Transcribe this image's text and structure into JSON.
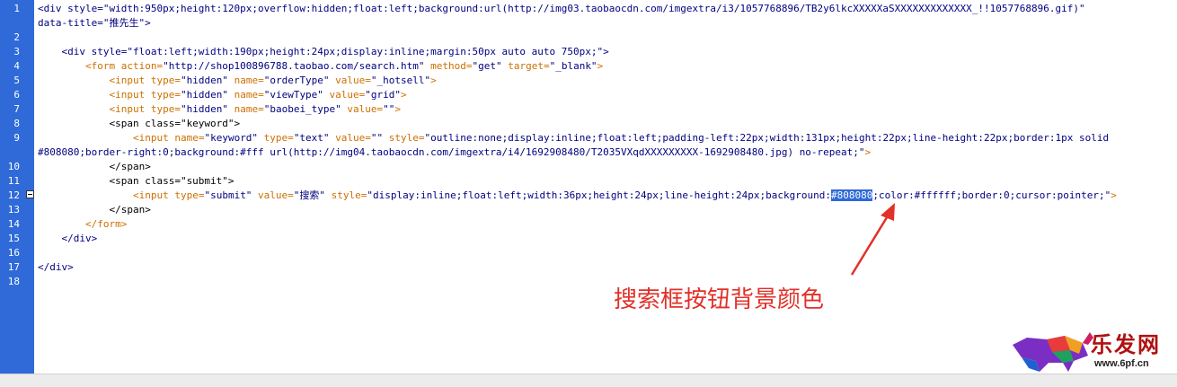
{
  "editor": {
    "line_numbers": [
      "1",
      "2",
      "3",
      "4",
      "5",
      "6",
      "7",
      "8",
      "9",
      "10",
      "11",
      "12",
      "13",
      "14",
      "15",
      "16",
      "17",
      "18"
    ],
    "lines": [
      {
        "num": 1,
        "parts": [
          {
            "text": "<div style=\"width:950px;height:120px;overflow:hidden;float:left;background:url(http://img03.taobaocdn.com/imgextra/i3/1057768896/TB2y6lkcXXXXXaSXXXXXXXXXXXXX_!!1057768896.gif)\"",
            "cls": "t"
          }
        ]
      },
      {
        "num": 0,
        "parts": [
          {
            "text": "data-title=\"推先生\">",
            "cls": "t"
          }
        ]
      },
      {
        "num": 2,
        "parts": []
      },
      {
        "num": 3,
        "parts": [
          {
            "text": "    <div style=\"float:left;width:190px;height:24px;display:inline;margin:50px auto auto 750px;\">",
            "cls": "t"
          }
        ]
      },
      {
        "num": 4,
        "parts": [
          {
            "text": "        <form ",
            "cls": "o"
          },
          {
            "text": "action=",
            "cls": "o"
          },
          {
            "text": "\"http://shop100896788.taobao.com/search.htm\"",
            "cls": "t"
          },
          {
            "text": " method=",
            "cls": "o"
          },
          {
            "text": "\"get\"",
            "cls": "t"
          },
          {
            "text": " target=",
            "cls": "o"
          },
          {
            "text": "\"_blank\"",
            "cls": "t"
          },
          {
            "text": ">",
            "cls": "o"
          }
        ]
      },
      {
        "num": 5,
        "parts": [
          {
            "text": "            <input ",
            "cls": "o"
          },
          {
            "text": "type=",
            "cls": "o"
          },
          {
            "text": "\"hidden\"",
            "cls": "t"
          },
          {
            "text": " name=",
            "cls": "o"
          },
          {
            "text": "\"orderType\"",
            "cls": "t"
          },
          {
            "text": " value=",
            "cls": "o"
          },
          {
            "text": "\"_hotsell\"",
            "cls": "t"
          },
          {
            "text": ">",
            "cls": "o"
          }
        ]
      },
      {
        "num": 6,
        "parts": [
          {
            "text": "            <input ",
            "cls": "o"
          },
          {
            "text": "type=",
            "cls": "o"
          },
          {
            "text": "\"hidden\"",
            "cls": "t"
          },
          {
            "text": " name=",
            "cls": "o"
          },
          {
            "text": "\"viewType\"",
            "cls": "t"
          },
          {
            "text": " value=",
            "cls": "o"
          },
          {
            "text": "\"grid\"",
            "cls": "t"
          },
          {
            "text": ">",
            "cls": "o"
          }
        ]
      },
      {
        "num": 7,
        "parts": [
          {
            "text": "            <input ",
            "cls": "o"
          },
          {
            "text": "type=",
            "cls": "o"
          },
          {
            "text": "\"hidden\"",
            "cls": "t"
          },
          {
            "text": " name=",
            "cls": "o"
          },
          {
            "text": "\"baobei_type\"",
            "cls": "t"
          },
          {
            "text": " value=",
            "cls": "o"
          },
          {
            "text": "\"\"",
            "cls": "t"
          },
          {
            "text": ">",
            "cls": "o"
          }
        ]
      },
      {
        "num": 8,
        "parts": [
          {
            "text": "            <span class=\"keyword\">",
            "cls": "a"
          }
        ]
      },
      {
        "num": 9,
        "parts": [
          {
            "text": "                <input ",
            "cls": "o"
          },
          {
            "text": "name=",
            "cls": "o"
          },
          {
            "text": "\"keyword\"",
            "cls": "t"
          },
          {
            "text": " type=",
            "cls": "o"
          },
          {
            "text": "\"text\"",
            "cls": "t"
          },
          {
            "text": " value=",
            "cls": "o"
          },
          {
            "text": "\"\"",
            "cls": "t"
          },
          {
            "text": " style=",
            "cls": "o"
          },
          {
            "text": "\"outline:none;display:inline;float:left;padding-left:22px;width:131px;height:22px;line-height:22px;border:1px solid",
            "cls": "t"
          }
        ]
      },
      {
        "num": 0,
        "parts": [
          {
            "text": "#808080;border-right:0;background:#fff url(http://img04.taobaocdn.com/imgextra/i4/1692908480/T2035VXqdXXXXXXXXX-1692908480.jpg) no-repeat;\"",
            "cls": "t"
          },
          {
            "text": ">",
            "cls": "o"
          }
        ]
      },
      {
        "num": 10,
        "parts": [
          {
            "text": "            </span>",
            "cls": "a"
          }
        ]
      },
      {
        "num": 11,
        "parts": [
          {
            "text": "            <span class=\"submit\">",
            "cls": "a"
          }
        ]
      },
      {
        "num": 12,
        "parts": [
          {
            "text": "                <input ",
            "cls": "o"
          },
          {
            "text": "type=",
            "cls": "o"
          },
          {
            "text": "\"submit\"",
            "cls": "t"
          },
          {
            "text": " value=",
            "cls": "o"
          },
          {
            "text": "\"搜索\"",
            "cls": "t"
          },
          {
            "text": " style=",
            "cls": "o"
          },
          {
            "text": "\"display:inline;float:left;width:36px;height:24px;line-height:24px;background:",
            "cls": "t"
          },
          {
            "text": "#808080",
            "cls": "hl"
          },
          {
            "text": ";color:#ffffff;border:0;cursor:pointer;\"",
            "cls": "t"
          },
          {
            "text": ">",
            "cls": "o"
          }
        ]
      },
      {
        "num": 13,
        "parts": [
          {
            "text": "            </span>",
            "cls": "a"
          }
        ]
      },
      {
        "num": 14,
        "parts": [
          {
            "text": "        </form>",
            "cls": "o"
          }
        ]
      },
      {
        "num": 15,
        "parts": [
          {
            "text": "    </div>",
            "cls": "t"
          }
        ]
      },
      {
        "num": 16,
        "parts": []
      },
      {
        "num": 17,
        "parts": [
          {
            "text": "</div>",
            "cls": "t"
          }
        ]
      },
      {
        "num": 18,
        "parts": []
      }
    ]
  },
  "annotation": {
    "text": "搜索框按钮背景颜色",
    "color": "#e2302a"
  },
  "watermark": {
    "logo_text": "乐发网",
    "url": "www.6pf.cn"
  },
  "colors": {
    "gutter": "#2f6ad8",
    "highlight": "#2f6ad8",
    "tag": "#000080",
    "attr": "#cc7000"
  }
}
